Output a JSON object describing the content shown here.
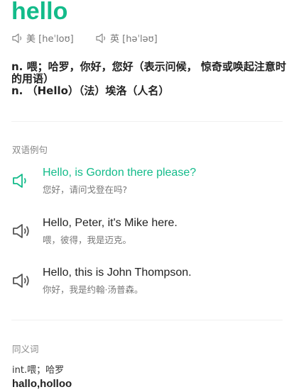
{
  "word": "hello",
  "pronunciations": [
    {
      "label": "美 [heˈloʊ]"
    },
    {
      "label": "英 [həˈləʊ]"
    }
  ],
  "definitions": [
    "n. 喂；哈罗，你好，您好（表示问候， 惊奇或唤起注意时的用语）",
    "n. （Hello）（法）埃洛（人名）"
  ],
  "bilingual_examples": {
    "title": "双语例句",
    "items": [
      {
        "en": "Hello, is Gordon there please?",
        "zh": "您好，请问戈登在吗?"
      },
      {
        "en": "Hello, Peter, it's Mike here.",
        "zh": "喂，彼得，我是迈克。"
      },
      {
        "en": "Hello, this is John Thompson.",
        "zh": "你好，我是约翰·汤普森。"
      }
    ]
  },
  "synonyms": {
    "title": "同义词",
    "definition": "int.喂；哈罗",
    "words": "hallo,holloo"
  },
  "colors": {
    "accent": "#13bb8a",
    "muted": "#888888"
  },
  "icons": {
    "speaker": "speaker-icon"
  }
}
